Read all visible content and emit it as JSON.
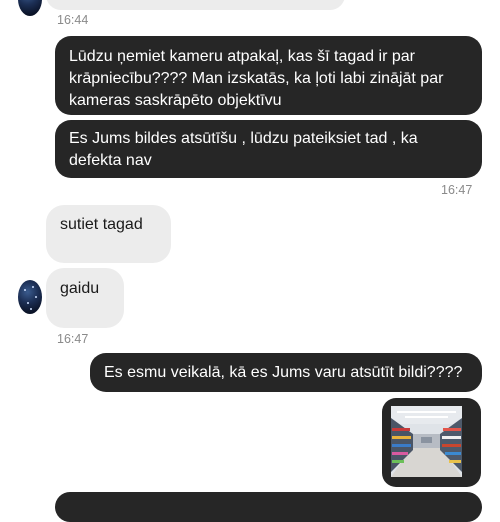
{
  "chat": {
    "ts_1": "16:44",
    "msg_out_1": "Lūdzu ņemiet kameru atpakaļ, kas šī tagad ir par krāpniecību???? Man izskatās, ka ļoti labi zinājāt par kameras saskrāpēto objektīvu",
    "msg_out_2": "Es Jums bildes atsūtīšu , lūdzu pateiksiet tad , ka defekta nav",
    "ts_2": "16:47",
    "msg_in_1": "sutiet tagad",
    "msg_in_2": "gaidu",
    "ts_3": "16:47",
    "msg_out_3": "Es esmu veikalā, kā es Jums varu atsūtīt bildi????",
    "photo_icon": "store-aisle-photo"
  },
  "colors": {
    "outgoing_bubble": "#262626",
    "incoming_bubble": "#ececec",
    "timestamp": "#8a8a8a"
  }
}
